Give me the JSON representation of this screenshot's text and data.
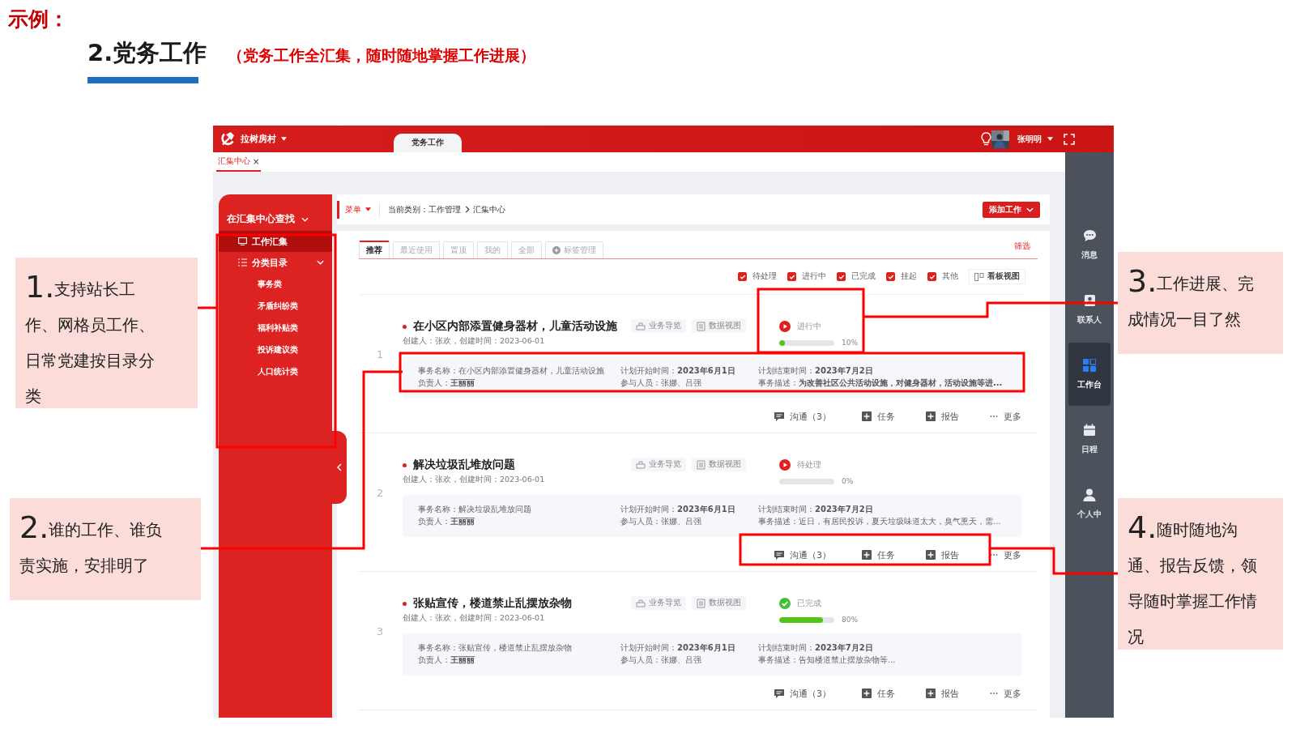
{
  "slide": {
    "label": "示例：",
    "title": "2.党务工作",
    "subtitle": "（党务工作全汇集，随时随地掌握工作进展）"
  },
  "app": {
    "topbar": {
      "village": "拉树房村",
      "tabs": [
        {
          "label": "党务工作",
          "selected": true
        }
      ],
      "user": "张明明"
    },
    "page_tabs": [
      {
        "label": "汇集中心",
        "selected": true,
        "close": "×"
      }
    ],
    "sidebar": {
      "title": "在汇集中心查找",
      "items": [
        {
          "label": "工作汇集",
          "kind": "monitor",
          "selected": true
        },
        {
          "label": "分类目录",
          "kind": "list",
          "selected": false,
          "expanded": true,
          "children": [
            {
              "label": "事务类"
            },
            {
              "label": "矛盾纠纷类"
            },
            {
              "label": "福利补贴类"
            },
            {
              "label": "投诉建议类"
            },
            {
              "label": "人口统计类"
            }
          ]
        }
      ]
    },
    "breadcrumb": {
      "menu": "菜单",
      "path": [
        "当前类别：工作管理",
        "汇集中心"
      ],
      "add_button": "添加工作"
    },
    "list_tabs": [
      {
        "label": "推荐",
        "selected": true
      },
      {
        "label": "最近使用",
        "selected": false
      },
      {
        "label": "置顶",
        "selected": false
      },
      {
        "label": "我的",
        "selected": false
      },
      {
        "label": "全部",
        "selected": false
      },
      {
        "label": "标签管理",
        "selected": false,
        "kind": "manage"
      }
    ],
    "filter_link": "筛选",
    "filters": [
      {
        "label": "待处理",
        "checked": true
      },
      {
        "label": "进行中",
        "checked": true
      },
      {
        "label": "已完成",
        "checked": true
      },
      {
        "label": "挂起",
        "checked": true
      },
      {
        "label": "其他",
        "checked": true
      }
    ],
    "board_view": "看板视图",
    "works": [
      {
        "index": "1",
        "title": "在小区内部添置健身器材，儿童活动设施",
        "chips": [
          {
            "kind": "guide",
            "label": "业务导览"
          },
          {
            "kind": "data",
            "label": "数据视图"
          }
        ],
        "meta": "创建人：张欢，创建时间：2023-06-01",
        "status": {
          "kind": "in_progress",
          "label": "进行中",
          "level": 0.1,
          "percent": "10%"
        },
        "details": [
          "事务名称：在小区内部添置健身器材，儿童活动设施",
          "负责人：**王丽丽**",
          "计划开始时间：**2023年6月1日**",
          "参与人员：张娜、吕强",
          "计划结束时间：**2023年7月2日**",
          "事务描述：**为改善社区公共活动设施，对健身器材，活动设施等进...**"
        ],
        "actions": [
          {
            "kind": "chat",
            "label": "沟通（3）"
          },
          {
            "kind": "task",
            "label": "任务"
          },
          {
            "kind": "report",
            "label": "报告"
          },
          {
            "kind": "more",
            "label": "更多"
          }
        ]
      },
      {
        "index": "2",
        "title": "解决垃圾乱堆放问题",
        "chips": [
          {
            "kind": "guide",
            "label": "业务导览"
          },
          {
            "kind": "data",
            "label": "数据视图"
          }
        ],
        "meta": "创建人：张欢，创建时间：2023-06-01",
        "status": {
          "kind": "pending",
          "label": "待处理",
          "level": 0,
          "percent": "0%"
        },
        "details": [
          "事务名称：解决垃圾乱堆放问题",
          "负责人：**王丽丽**",
          "计划开始时间：**2023年6月1日**",
          "参与人员：张娜、吕强",
          "计划结束时间：**2023年7月2日**",
          "事务描述：近日，有居民投诉，夏天垃圾味道太大，臭气熏天，需..."
        ],
        "actions": [
          {
            "kind": "chat",
            "label": "沟通（3）"
          },
          {
            "kind": "task",
            "label": "任务"
          },
          {
            "kind": "report",
            "label": "报告"
          },
          {
            "kind": "more",
            "label": "更多"
          }
        ]
      },
      {
        "index": "3",
        "title": "张贴宣传，楼道禁止乱摆放杂物",
        "chips": [
          {
            "kind": "guide",
            "label": "业务导览"
          },
          {
            "kind": "data",
            "label": "数据视图"
          }
        ],
        "meta": "创建人：张欢，创建时间：2023-06-01",
        "status": {
          "kind": "done",
          "label": "已完成",
          "level": 0.8,
          "percent": "80%"
        },
        "details": [
          "事务名称：张贴宣传，楼道禁止乱摆放杂物",
          "负责人：**王丽丽**",
          "计划开始时间：**2023年6月1日**",
          "参与人员：张娜、吕强",
          "计划结束时间：**2023年7月2日**",
          "事务描述：告知楼道禁止摆放杂物等..."
        ],
        "actions": [
          {
            "kind": "chat",
            "label": "沟通（3）"
          },
          {
            "kind": "task",
            "label": "任务"
          },
          {
            "kind": "report",
            "label": "报告"
          },
          {
            "kind": "more",
            "label": "更多"
          }
        ]
      }
    ],
    "rail": [
      {
        "kind": "chat",
        "label": "消息",
        "selected": false
      },
      {
        "kind": "contact",
        "label": "联系人",
        "selected": false
      },
      {
        "kind": "workbench",
        "label": "工作台",
        "selected": true
      },
      {
        "kind": "calendar",
        "label": "日程",
        "selected": false
      },
      {
        "kind": "person",
        "label": "个人中",
        "selected": false
      }
    ]
  },
  "callouts": [
    {
      "number": "1.",
      "text": "支持站长工作、网格员工作、日常党建按目录分类"
    },
    {
      "number": "2.",
      "text": "谁的工作、谁负责实施，安排明了"
    },
    {
      "number": "3.",
      "text": "工作进展、完成情况一目了然"
    },
    {
      "number": "4.",
      "text": "随时随地沟通、报告反馈，领导随时掌握工作情况"
    }
  ]
}
